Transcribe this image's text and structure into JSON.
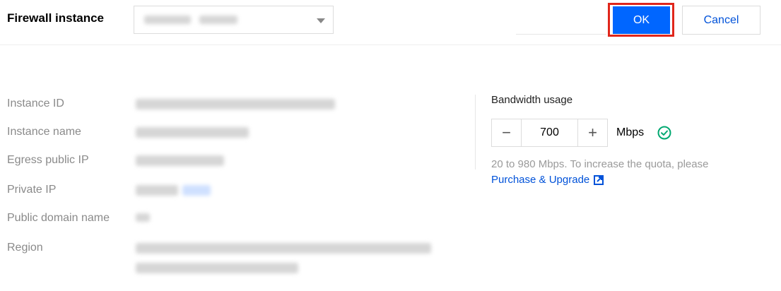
{
  "header": {
    "firewall_label": "Firewall instance",
    "ok_label": "OK",
    "cancel_label": "Cancel"
  },
  "details": {
    "rows": [
      {
        "label": "Instance ID"
      },
      {
        "label": "Instance name"
      },
      {
        "label": "Egress public IP"
      },
      {
        "label": "Private IP"
      },
      {
        "label": "Public domain name"
      },
      {
        "label": "Region"
      }
    ]
  },
  "bandwidth": {
    "label": "Bandwidth usage",
    "value": "700",
    "minus": "−",
    "plus": "+",
    "unit": "Mbps",
    "hint": "20 to 980 Mbps. To increase the quota, please",
    "link_label": "Purchase & Upgrade"
  },
  "colors": {
    "primary": "#0066ff",
    "link": "#0052d9",
    "highlight": "#e0261b",
    "success": "#00a870"
  },
  "icons": {
    "caret": "chevron-down-icon",
    "check": "check-circle-icon",
    "external": "external-link-icon"
  }
}
